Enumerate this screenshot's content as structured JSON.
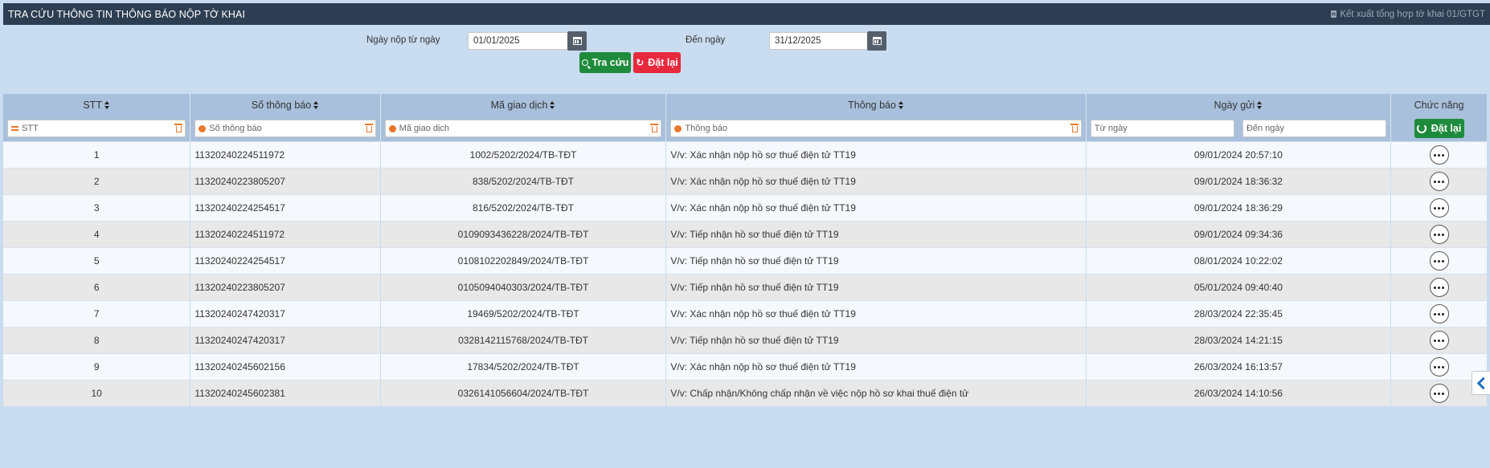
{
  "header": {
    "title": "TRA CỨU THÔNG TIN THÔNG BÁO NỘP TỜ KHAI",
    "export_label": "Kết xuất tổng hợp tờ khai 01/GTGT"
  },
  "search": {
    "from_label": "Ngày nộp từ ngày",
    "from_value": "01/01/2025",
    "to_label": "Đến ngày",
    "to_value": "31/12/2025",
    "search_button": "Tra cứu",
    "reset_button": "Đặt lại"
  },
  "table": {
    "columns": [
      "STT",
      "Số thông báo",
      "Mã giao dịch",
      "Thông báo",
      "Ngày gửi",
      "Chức năng"
    ],
    "filters": {
      "stt": "STT",
      "so_thong_bao": "Số thông báo",
      "ma_giao_dich": "Mã giao dịch",
      "thong_bao": "Thông báo",
      "tu_ngay": "Từ ngày",
      "den_ngay": "Đến ngày",
      "reset_label": "Đặt lại"
    },
    "rows": [
      {
        "stt": "1",
        "so": "11320240224511972",
        "ma": "1002/5202/2024/TB-TĐT",
        "tb": "V/v: Xác nhận nộp hồ sơ thuế điện tử TT19",
        "ngay": "09/01/2024 20:57:10"
      },
      {
        "stt": "2",
        "so": "11320240223805207",
        "ma": "838/5202/2024/TB-TĐT",
        "tb": "V/v: Xác nhận nộp hồ sơ thuế điện tử TT19",
        "ngay": "09/01/2024 18:36:32"
      },
      {
        "stt": "3",
        "so": "11320240224254517",
        "ma": "816/5202/2024/TB-TĐT",
        "tb": "V/v: Xác nhận nộp hồ sơ thuế điện tử TT19",
        "ngay": "09/01/2024 18:36:29"
      },
      {
        "stt": "4",
        "so": "11320240224511972",
        "ma": "0109093436228/2024/TB-TĐT",
        "tb": "V/v: Tiếp nhận hồ sơ thuế điện tử TT19",
        "ngay": "09/01/2024 09:34:36"
      },
      {
        "stt": "5",
        "so": "11320240224254517",
        "ma": "0108102202849/2024/TB-TĐT",
        "tb": "V/v: Tiếp nhận hồ sơ thuế điện tử TT19",
        "ngay": "08/01/2024 10:22:02"
      },
      {
        "stt": "6",
        "so": "11320240223805207",
        "ma": "0105094040303/2024/TB-TĐT",
        "tb": "V/v: Tiếp nhận hồ sơ thuế điện tử TT19",
        "ngay": "05/01/2024 09:40:40"
      },
      {
        "stt": "7",
        "so": "11320240247420317",
        "ma": "19469/5202/2024/TB-TĐT",
        "tb": "V/v: Xác nhận nộp hồ sơ thuế điện tử TT19",
        "ngay": "28/03/2024 22:35:45"
      },
      {
        "stt": "8",
        "so": "11320240247420317",
        "ma": "0328142115768/2024/TB-TĐT",
        "tb": "V/v: Tiếp nhận hồ sơ thuế điện tử TT19",
        "ngay": "28/03/2024 14:21:15"
      },
      {
        "stt": "9",
        "so": "11320240245602156",
        "ma": "17834/5202/2024/TB-TĐT",
        "tb": "V/v: Xác nhận nộp hồ sơ thuế điện tử TT19",
        "ngay": "26/03/2024 16:13:57"
      },
      {
        "stt": "10",
        "so": "11320240245602381",
        "ma": "0326141056604/2024/TB-TĐT",
        "tb": "V/v: Chấp nhận/Không chấp nhận về việc nộp hồ sơ khai thuế điện tử",
        "ngay": "26/03/2024 14:10:56"
      }
    ]
  },
  "icons": {
    "export": "document-icon",
    "calendar": "calendar-icon",
    "search": "search-icon",
    "reset": "refresh-icon",
    "clear": "trash-icon",
    "more": "more-options-icon",
    "collapse": "chevron-left-icon"
  },
  "colors": {
    "header_bg": "#2e3e52",
    "panel_bg": "#c9dcf0",
    "table_header_bg": "#a8c0dc",
    "primary_green": "#1e8b3c",
    "danger_red": "#e8283c",
    "filter_orange": "#e8782a"
  }
}
